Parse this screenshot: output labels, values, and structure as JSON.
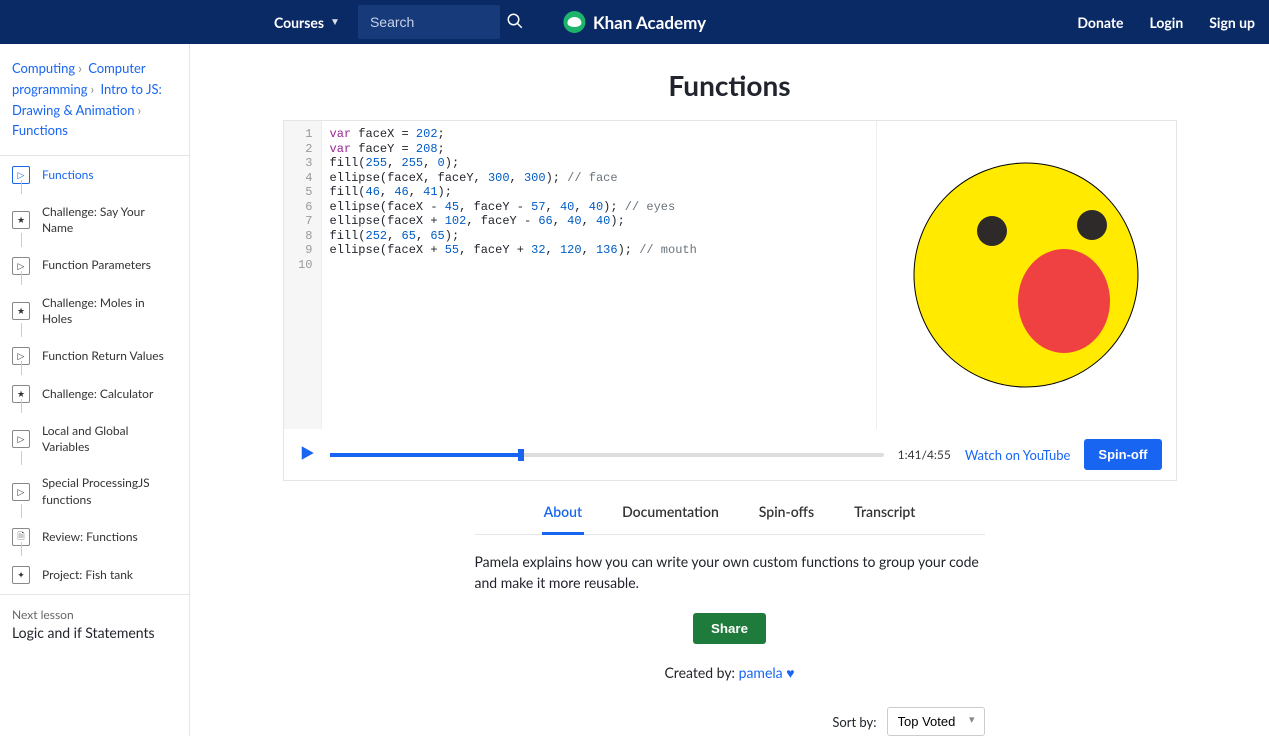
{
  "topbar": {
    "courses": "Courses",
    "search_placeholder": "Search",
    "brand": "Khan Academy",
    "donate": "Donate",
    "login": "Login",
    "signup": "Sign up"
  },
  "breadcrumbs": [
    "Computing",
    "Computer programming",
    "Intro to JS: Drawing & Animation",
    "Functions"
  ],
  "lessons": [
    {
      "icon": "play",
      "label": "Functions",
      "active": true
    },
    {
      "icon": "star",
      "label": "Challenge: Say Your Name"
    },
    {
      "icon": "play",
      "label": "Function Parameters"
    },
    {
      "icon": "star",
      "label": "Challenge: Moles in Holes"
    },
    {
      "icon": "play",
      "label": "Function Return Values"
    },
    {
      "icon": "star",
      "label": "Challenge: Calculator"
    },
    {
      "icon": "play",
      "label": "Local and Global Variables"
    },
    {
      "icon": "play",
      "label": "Special ProcessingJS functions"
    },
    {
      "icon": "doc",
      "label": "Review: Functions"
    },
    {
      "icon": "proj",
      "label": "Project: Fish tank"
    }
  ],
  "next_lesson": {
    "label": "Next lesson",
    "title": "Logic and if Statements"
  },
  "page_title": "Functions",
  "code_lines": [
    "var faceX = 202;",
    "var faceY = 208;",
    "fill(255, 255, 0);",
    "ellipse(faceX, faceY, 300, 300); // face",
    "fill(46, 46, 41);",
    "ellipse(faceX - 45, faceY - 57, 40, 40); // eyes",
    "ellipse(faceX + 102, faceY - 66, 40, 40);",
    "fill(252, 65, 65);",
    "ellipse(faceX + 55, faceY + 32, 120, 136); // mouth",
    ""
  ],
  "controls": {
    "time": "1:41/4:55",
    "watch_on_youtube": "Watch on YouTube",
    "spinoff": "Spin-off",
    "progress_pct": 34
  },
  "tabs": [
    "About",
    "Documentation",
    "Spin-offs",
    "Transcript"
  ],
  "active_tab": 0,
  "about_text": "Pamela explains how you can write your own custom functions to group your code and make it more reusable.",
  "share": "Share",
  "created_by_label": "Created by: ",
  "created_by_name": "pamela",
  "sort": {
    "label": "Sort by:",
    "selected": "Top Voted"
  }
}
